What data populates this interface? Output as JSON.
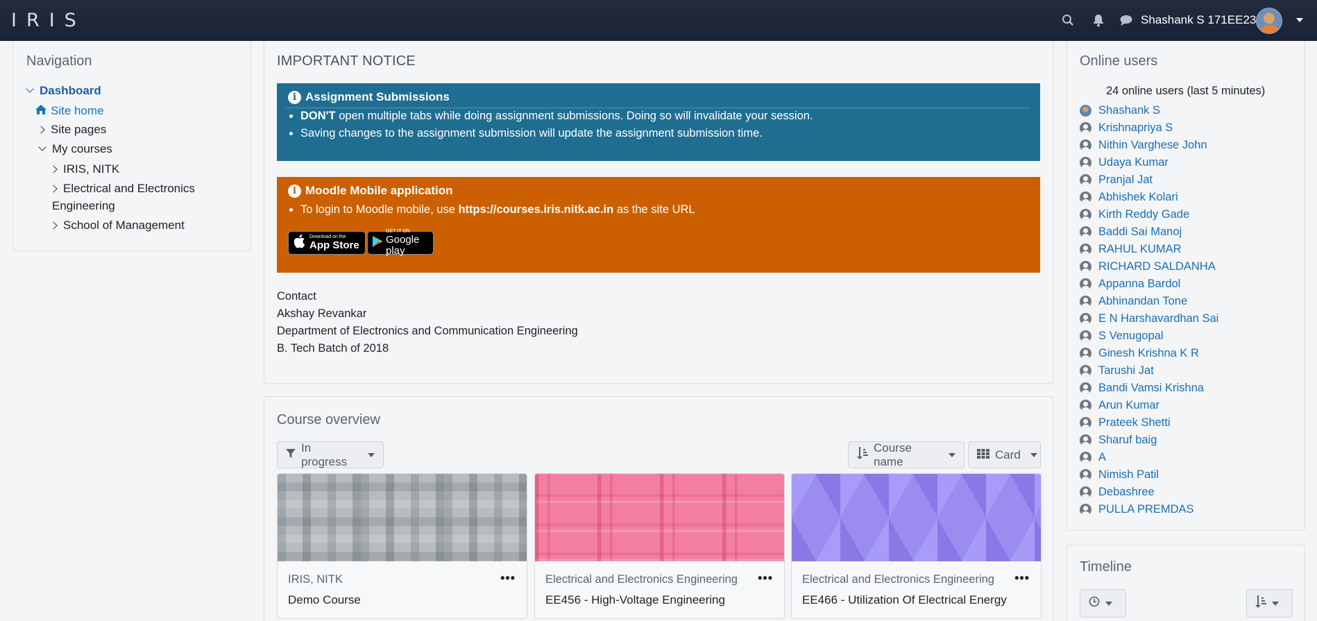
{
  "header": {
    "brand": "IRIS",
    "user_name": "Shashank S 171EE238",
    "icons": [
      "search-icon",
      "bell-icon",
      "chat-icon"
    ]
  },
  "navigation": {
    "title": "Navigation",
    "items": [
      {
        "label": "Dashboard"
      },
      {
        "label": "Site home"
      },
      {
        "label": "Site pages"
      },
      {
        "label": "My courses"
      },
      {
        "label": "IRIS, NITK"
      },
      {
        "label": "Electrical and Electronics"
      },
      {
        "label": "Engineering"
      },
      {
        "label": "School of Management"
      }
    ]
  },
  "notice": {
    "title": "IMPORTANT NOTICE",
    "assignment": {
      "heading": "Assignment Submissions",
      "bullet1_strong": "DON'T",
      "bullet1_rest": " open multiple tabs while doing assignment submissions. Doing so will invalidate your session.",
      "bullet2": "Saving changes to the assignment submission will update the assignment submission time."
    },
    "mobile": {
      "heading": "Moodle Mobile application",
      "bullet_pre": "To login to Moodle mobile, use ",
      "bullet_url": "https://courses.iris.nitk.ac.in",
      "bullet_post": " as the site URL",
      "appstore_small": "Download on the",
      "appstore_big": "App Store",
      "gplay_small": "GET IT ON",
      "gplay_big": "Google play"
    },
    "contact": [
      "Contact",
      "Akshay Revankar",
      "Department of Electronics and Communication Engineering",
      "B. Tech Batch of 2018"
    ]
  },
  "course_overview": {
    "title": "Course overview",
    "filter_label": "In progress",
    "sort_label": "Course name",
    "view_label": "Card",
    "courses": [
      {
        "category": "IRIS, NITK",
        "name": "Demo Course"
      },
      {
        "category": "Electrical and Electronics Engineering",
        "name": "EE456 - High-Voltage Engineering"
      },
      {
        "category": "Electrical and Electronics Engineering",
        "name": "EE466 - Utilization Of Electrical Energy"
      }
    ]
  },
  "online_users": {
    "title": "Online users",
    "summary": "24 online users (last 5 minutes)",
    "users": [
      "Shashank S",
      "Krishnapriya S",
      "Nithin Varghese John",
      "Udaya Kumar",
      "Pranjal Jat",
      "Abhishek Kolari",
      "Kirth Reddy Gade",
      "Baddi Sai Manoj",
      "RAHUL KUMAR",
      "RICHARD SALDANHA",
      "Appanna Bardol",
      "Abhinandan Tone",
      "E N Harshavardhan Sai",
      "S Venugopal",
      "Ginesh Krishna K R",
      "Tarushi Jat",
      "Bandi Vamsi Krishna",
      "Arun Kumar",
      "Prateek Shetti",
      "Sharuf baig",
      "A",
      "Nimish Patil",
      "Debashree",
      "PULLA PREMDAS"
    ]
  },
  "timeline": {
    "title": "Timeline"
  }
}
